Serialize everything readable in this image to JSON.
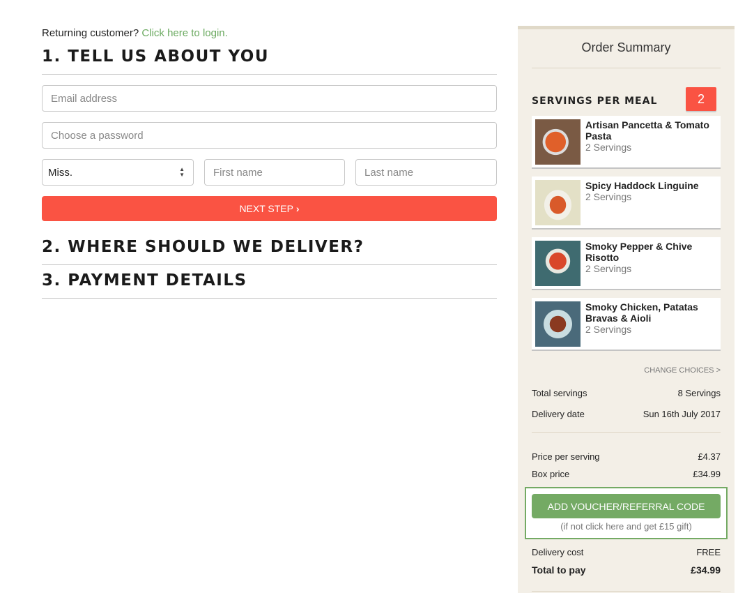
{
  "login": {
    "prompt": "Returning customer?",
    "link": "Click here to login."
  },
  "steps": {
    "one": "1. TELL US ABOUT YOU",
    "two": "2. WHERE SHOULD WE DELIVER?",
    "three": "3. PAYMENT DETAILS"
  },
  "form": {
    "email_placeholder": "Email address",
    "password_placeholder": "Choose a password",
    "title_value": "Miss.",
    "first_placeholder": "First name",
    "last_placeholder": "Last name",
    "next_label": "NEXT STEP"
  },
  "summary": {
    "title": "Order Summary",
    "servings_label": "SERVINGS PER MEAL",
    "servings_value": "2",
    "meals": [
      {
        "name": "Artisan Pancetta & Tomato Pasta",
        "servings": "2 Servings"
      },
      {
        "name": "Spicy Haddock Linguine",
        "servings": "2 Servings"
      },
      {
        "name": "Smoky Pepper & Chive Risotto",
        "servings": "2 Servings"
      },
      {
        "name": "Smoky Chicken, Patatas Bravas & Aioli",
        "servings": "2 Servings"
      }
    ],
    "change_choices": "CHANGE CHOICES >",
    "total_servings": {
      "label": "Total servings",
      "value": "8 Servings"
    },
    "delivery_date": {
      "label": "Delivery date",
      "value": "Sun 16th July 2017"
    },
    "price_per_serving": {
      "label": "Price per serving",
      "value": "£4.37"
    },
    "box_price": {
      "label": "Box price",
      "value": "£34.99"
    },
    "voucher_label": "ADD VOUCHER/REFERRAL CODE",
    "voucher_sub": "(if not click here and get £15 gift)",
    "delivery_cost": {
      "label": "Delivery cost",
      "value": "FREE"
    },
    "total": {
      "label": "Total to pay",
      "value": "£34.99"
    }
  },
  "colors": {
    "accent": "#fa5343",
    "green": "#74aa64",
    "sidebar_bg": "#f3efe7"
  }
}
